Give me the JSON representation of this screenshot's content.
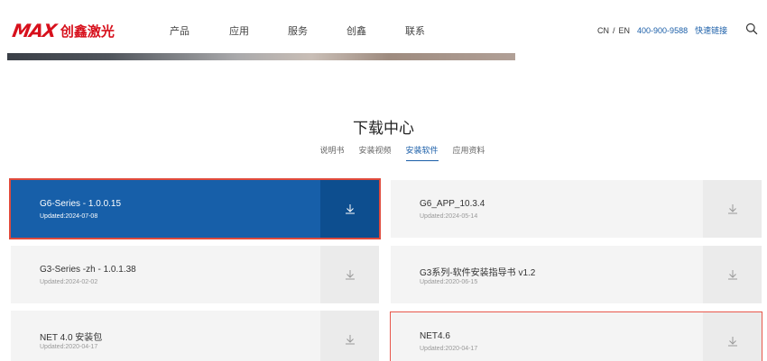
{
  "header": {
    "logo_mark": "MAX",
    "logo_text": "创鑫激光",
    "nav": [
      "产品",
      "应用",
      "服务",
      "创鑫",
      "联系"
    ],
    "lang_cn": "CN",
    "lang_sep": "/",
    "lang_en": "EN",
    "phone": "400-900-9588",
    "quick_link": "快速链接"
  },
  "section": {
    "title": "下载中心",
    "tabs": [
      "说明书",
      "安装视频",
      "安装软件",
      "应用资料"
    ],
    "active_tab": "安装软件"
  },
  "downloads": [
    {
      "name": "G6-Series - 1.0.0.15",
      "date": "Updated:2024-07-08"
    },
    {
      "name": "G6_APP_10.3.4",
      "date": "Updated:2024-05-14"
    },
    {
      "name": "G3-Series -zh - 1.0.1.38",
      "date": "Updated:2024-02-02"
    },
    {
      "name": "G3系列-软件安装指导书 v1.2",
      "date": "Updated:2020-06-15"
    },
    {
      "name": "NET 4.0 安装包",
      "date": "Updated:2020-04-17"
    },
    {
      "name": "NET4.6",
      "date": "Updated:2020-04-17"
    }
  ],
  "colors": {
    "brand_red": "#d7101c",
    "accent_blue": "#175fa9",
    "highlight_outline": "#e04a3c"
  },
  "icons": {
    "download": "download-arrow-icon",
    "search": "search-icon"
  }
}
